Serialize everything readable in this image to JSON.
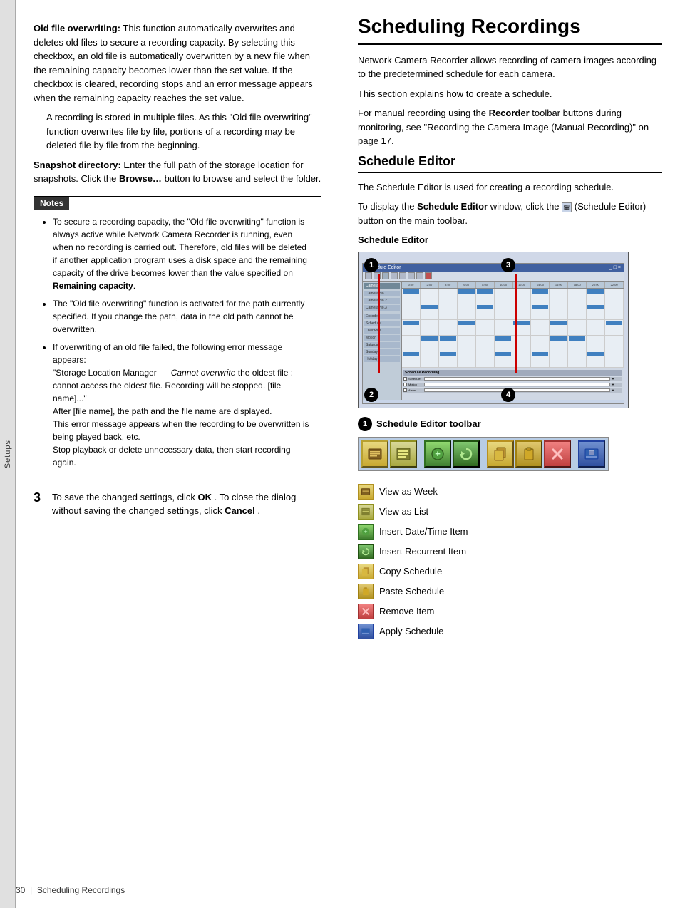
{
  "sidebar": {
    "label": "Setups"
  },
  "page_footer": {
    "page_num": "30",
    "label": "Scheduling Recordings"
  },
  "left_col": {
    "sections": [
      {
        "term": "Old file overwriting:",
        "definition": "This function automatically overwrites and deletes old files to secure a recording capacity. By selecting this checkbox, an old file is automatically overwritten by a new file when the remaining capacity becomes lower than the set value. If the checkbox is cleared, recording stops and an error message appears when the remaining capacity reaches the set value.",
        "extra_para": "A recording is stored in multiple files. As this \"Old file overwriting\" function overwrites file by file, portions of a recording may be deleted file by file from the beginning."
      },
      {
        "term": "Snapshot directory:",
        "definition": "Enter the full path of the storage location for snapshots. Click the",
        "bold_part": "Browse…",
        "definition2": "button to browse and select the folder."
      }
    ],
    "notes": {
      "header": "Notes",
      "items": [
        "To secure a recording capacity, the \"Old file overwriting\" function is always active while Network Camera Recorder is running, even when no recording is carried out.  Therefore, old files will be deleted if another application program uses a disk space and the remaining capacity of the drive becomes lower than the value specified on Remaining capacity.",
        "The \"Old file overwriting\" function is activated for the path currently specified. If you change the path, data in the old path cannot be overwritten.",
        "If overwriting of an old file failed, the following error message appears:\n\"Storage Location Manager   Cannot overwrite the oldest file : cannot access the oldest file. Recording will be stopped. [file name]...\"\nAfter [file name], the path and the file name are displayed.\nThis error message appears when the recording to be overwritten is being played back, etc.\nStop playback or delete unnecessary data, then start recording again."
      ]
    },
    "step3": {
      "number": "3",
      "text1": "To save the changed settings, click",
      "ok_label": "OK",
      "text2": ". To close the dialog without saving the changed settings, click",
      "cancel_label": "Cancel",
      "text3": "."
    }
  },
  "right_col": {
    "title": "Scheduling Recordings",
    "intro1": "Network Camera Recorder allows recording of camera images according to the predetermined schedule for each camera.",
    "intro2": "This section explains how to create a schedule.",
    "intro3_prefix": "For manual recording using the",
    "intro3_bold": "Recorder",
    "intro3_suffix": "toolbar buttons during monitoring, see \"Recording the Camera Image (Manual Recording)\" on page 17.",
    "schedule_editor_section": {
      "subtitle": "Schedule Editor",
      "description1": "The Schedule Editor is used for creating a recording schedule.",
      "description2_prefix": "To display the",
      "description2_bold": "Schedule Editor",
      "description2_suffix": "window, click the",
      "description2_end": "(Schedule Editor) button on the main toolbar.",
      "image_label": "Schedule Editor",
      "circle_labels": [
        "1",
        "2",
        "3",
        "4"
      ]
    },
    "toolbar_section": {
      "circle": "1",
      "label": "Schedule Editor toolbar",
      "icons": [
        {
          "id": "view-week-icon",
          "color": "yellow",
          "symbol": "🗓"
        },
        {
          "id": "view-list-icon",
          "color": "yellow",
          "symbol": "☰"
        },
        {
          "id": "sep1",
          "color": "separator",
          "symbol": ""
        },
        {
          "id": "insert-datetime-icon",
          "color": "green",
          "symbol": "⊕"
        },
        {
          "id": "insert-recurrent-icon",
          "color": "green",
          "symbol": "↺"
        },
        {
          "id": "sep2",
          "color": "separator",
          "symbol": ""
        },
        {
          "id": "copy-schedule-icon",
          "color": "yellow",
          "symbol": "⧉"
        },
        {
          "id": "paste-schedule-icon",
          "color": "yellow",
          "symbol": "📋"
        },
        {
          "id": "remove-item-icon",
          "color": "red",
          "symbol": "✕"
        },
        {
          "id": "sep3",
          "color": "separator",
          "symbol": ""
        },
        {
          "id": "apply-schedule-icon",
          "color": "darkblue",
          "symbol": "💾"
        }
      ],
      "items": [
        {
          "icon": "🗓",
          "label": "View as Week"
        },
        {
          "icon": "☰",
          "label": "View as List"
        },
        {
          "icon": "⊕",
          "label": "Insert Date/Time Item"
        },
        {
          "icon": "↺",
          "label": "Insert Recurrent Item"
        },
        {
          "icon": "⧉",
          "label": "Copy Schedule"
        },
        {
          "icon": "📋",
          "label": "Paste Schedule"
        },
        {
          "icon": "✕",
          "label": "Remove Item"
        },
        {
          "icon": "💾",
          "label": "Apply Schedule"
        }
      ]
    }
  }
}
